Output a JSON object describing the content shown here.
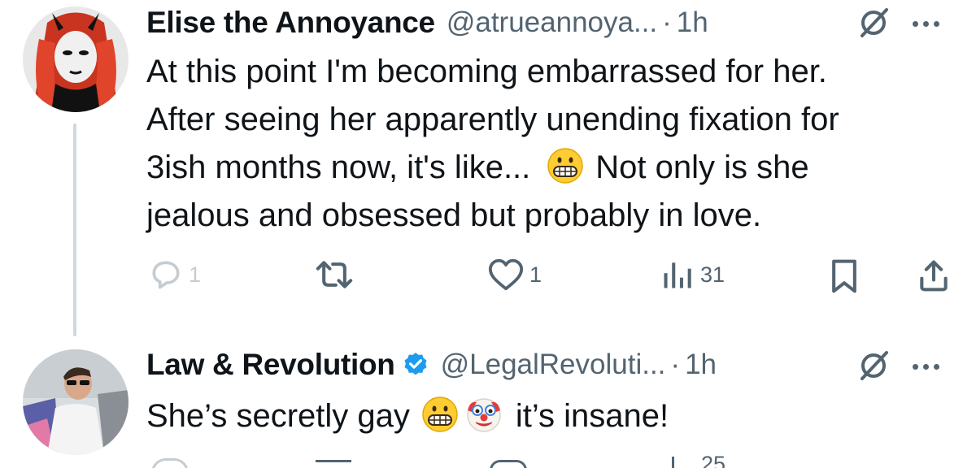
{
  "tweets": [
    {
      "author_name": "Elise the Annoyance",
      "handle": "@atrueannoya...",
      "separator": "·",
      "time": "1h",
      "verified": false,
      "avatar_icon": "red-haired-devil-horns-avatar",
      "lines": [
        "At this point I'm becoming embarrassed for her.",
        "After seeing her apparently unending fixation for",
        "3ish months now, it's like...",
        "Not only is she",
        "jealous and obsessed but probably in love."
      ],
      "emoji": [
        "grimacing-face"
      ],
      "stats": {
        "replies": "1",
        "likes": "1",
        "views": "31"
      }
    },
    {
      "author_name": "Law & Revolution",
      "handle": "@LegalRevoluti...",
      "separator": "·",
      "time": "1h",
      "verified": true,
      "avatar_icon": "person-sunglasses-pride-flag-avatar",
      "text_start": "She’s secretly gay",
      "text_end": "it’s insane!",
      "emoji": [
        "grimacing-face",
        "clown-face"
      ],
      "stats": {
        "views_partial": "25"
      }
    }
  ],
  "colors": {
    "text": "#0f1419",
    "secondary": "#536471",
    "verified": "#1d9bf0",
    "thread_line": "#cfd9de"
  }
}
